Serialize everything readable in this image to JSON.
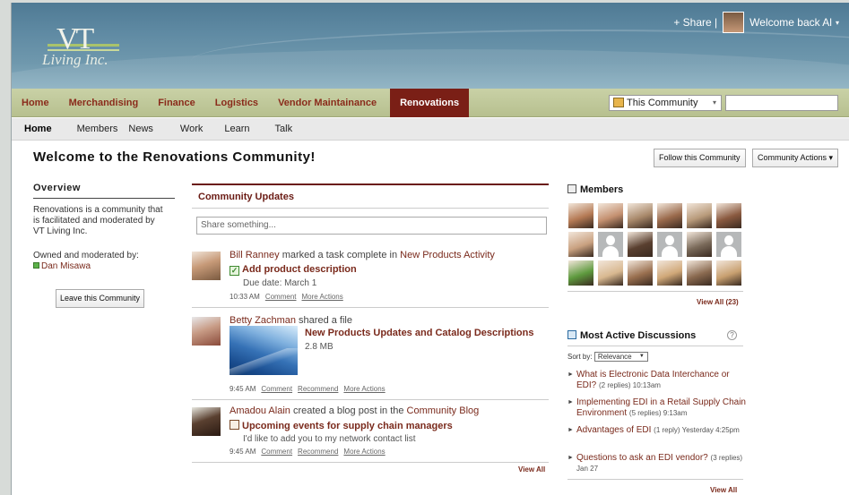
{
  "header": {
    "logo_mark": "VT",
    "logo_name": "Living Inc.",
    "share_label": "+ Share |",
    "welcome_label": "Welcome back Al",
    "caret": "▾"
  },
  "main_nav": {
    "items": [
      "Home",
      "Merchandising",
      "Finance",
      "Logistics",
      "Vendor Maintainance"
    ],
    "active": "Renovations"
  },
  "search": {
    "scope_label": "This Community",
    "scope_arrow": "▾",
    "placeholder": ""
  },
  "sub_nav": {
    "items": [
      "Home",
      "Members",
      "News",
      "Work",
      "Learn",
      "Talk"
    ]
  },
  "page": {
    "title": "Welcome to the Renovations Community!",
    "follow_button": "Follow this Community",
    "actions_button": "Community Actions ▾"
  },
  "overview": {
    "heading": "Overview",
    "description": "Renovations is a community that is facilitated and moderated by VT Living Inc.",
    "owned_label": "Owned and moderated by:",
    "owner": "Dan Misawa",
    "leave_button": "Leave this Community"
  },
  "updates": {
    "heading": "Community Updates",
    "share_placeholder": "Share something...",
    "entries": [
      {
        "actor": "Bill Ranney",
        "action": "marked a task complete in",
        "target": "New Products Activity",
        "item_title": "Add product description",
        "detail": "Due date: March 1",
        "time": "10:33 AM",
        "links": [
          "Comment",
          "More Actions"
        ]
      },
      {
        "actor": "Betty Zachman",
        "action": "shared a file",
        "item_title": "New Products Updates and Catalog Descriptions",
        "detail": "2.8 MB",
        "time": "9:45 AM",
        "links": [
          "Comment",
          "Recommend",
          "More Actions"
        ]
      },
      {
        "actor": "Amadou Alain",
        "action": "created a blog post in the",
        "target": "Community Blog",
        "item_title": "Upcoming events for supply chain managers",
        "detail": "I'd like to add you to my network contact list",
        "time": "9:45 AM",
        "links": [
          "Comment",
          "Recommend",
          "More Actions"
        ]
      }
    ],
    "view_all": "View All"
  },
  "members": {
    "heading": "Members",
    "view_all": "View All",
    "count": "(23)",
    "faces": [
      "#b57a55",
      "#c49070",
      "#a8886a",
      "#9a6a4c",
      "#b89a7a",
      "#8a5a40",
      "#c9a180",
      "anon",
      "#5a4030",
      "anon",
      "#7a6a5a",
      "anon",
      "#5e9a3e",
      "#d8b890",
      "#9a7050",
      "#d0a878",
      "#8a6a50",
      "#c8a070"
    ]
  },
  "discussions": {
    "heading": "Most Active Discussions",
    "help": "?",
    "sort_label": "Sort by:",
    "sort_value": "Relevance",
    "sort_arrow": "▼",
    "items": [
      {
        "title": "What is Electronic Data Interchance or EDI?",
        "meta": "(2 replies) 10:13am"
      },
      {
        "title": "Implementing EDI in a Retail Supply Chain Environment",
        "meta": "(5 replies) 9:13am"
      },
      {
        "title": "Advantages of EDI",
        "meta": "(1 reply) Yesterday 4:25pm"
      },
      {
        "title": "Questions to ask an EDI vendor?",
        "meta": "(3 replies) Jan 27"
      }
    ],
    "view_all": "View All"
  },
  "colors": {
    "brand": "#7a1f16",
    "link": "#7a2a1c",
    "nav_bg": "#c9d1a6"
  }
}
